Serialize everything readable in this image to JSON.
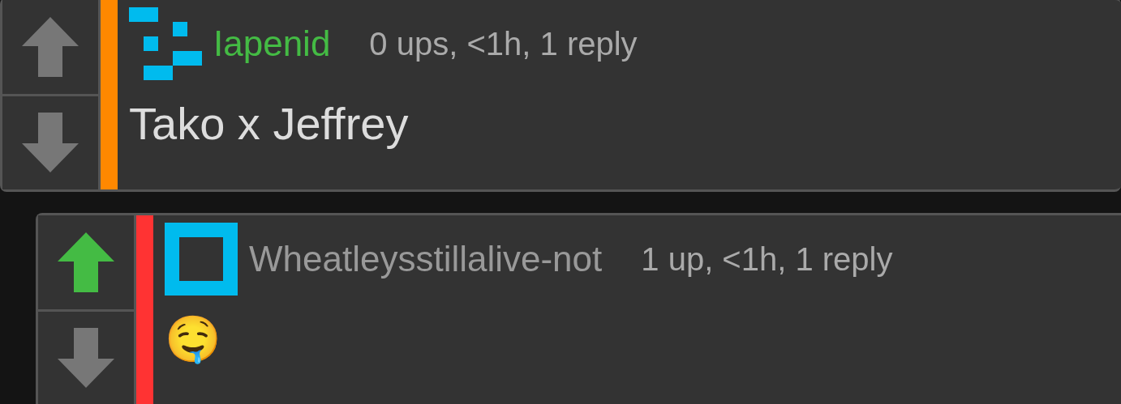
{
  "comments": [
    {
      "user": {
        "name": "Iapenid",
        "color": "#44bb44"
      },
      "avatar": {
        "kind": "blocks"
      },
      "meta": "0 ups, <1h, 1 reply",
      "body": "Tako x Jeffrey",
      "color": "#ff8800",
      "upvoted": false,
      "downvoted": false,
      "nested": false
    },
    {
      "user": {
        "name": "Wheatleysstillalive-not",
        "color": "#999999"
      },
      "avatar": {
        "kind": "square"
      },
      "meta": "1 up, <1h, 1 reply",
      "body": "🤤",
      "color": "#ff3333",
      "upvoted": true,
      "downvoted": false,
      "nested": true
    }
  ]
}
